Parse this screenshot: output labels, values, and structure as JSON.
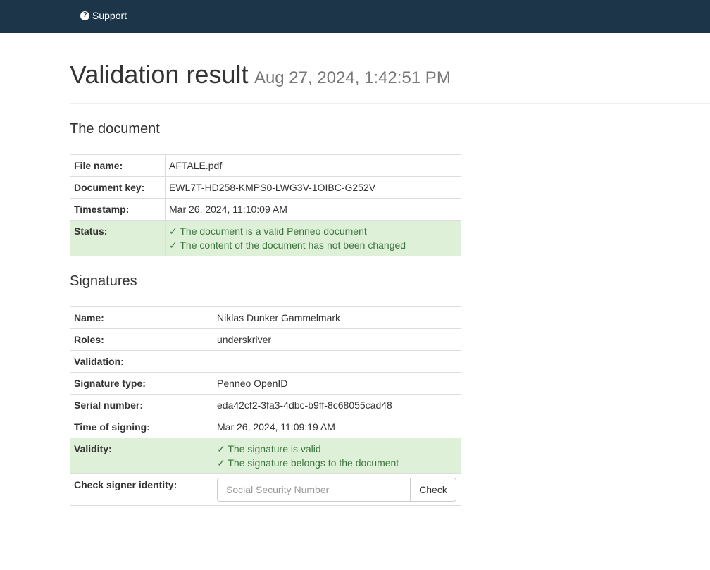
{
  "nav": {
    "support_label": "Support",
    "support_icon": "question-circle-icon"
  },
  "header": {
    "title": "Validation result",
    "timestamp": "Aug 27, 2024, 1:42:51 PM"
  },
  "document_section": {
    "title": "The document",
    "rows": [
      {
        "key": "File name:",
        "value": "AFTALE.pdf"
      },
      {
        "key": "Document key:",
        "value": "EWL7T-HD258-KMPS0-LWG3V-1OIBC-G252V"
      },
      {
        "key": "Timestamp:",
        "value": "Mar 26, 2024, 11:10:09 AM"
      }
    ],
    "status": {
      "key": "Status:",
      "lines": [
        "✓ The document is a valid Penneo document",
        "✓ The content of the document has not been changed"
      ]
    }
  },
  "signatures_section": {
    "title": "Signatures",
    "rows": [
      {
        "key": "Name:",
        "value": "Niklas Dunker Gammelmark"
      },
      {
        "key": "Roles:",
        "value": "underskriver"
      },
      {
        "key": "Validation:",
        "value": ""
      },
      {
        "key": "Signature type:",
        "value": "Penneo OpenID"
      },
      {
        "key": "Serial number:",
        "value": "eda42cf2-3fa3-4dbc-b9ff-8c68055cad48"
      },
      {
        "key": "Time of signing:",
        "value": "Mar 26, 2024, 11:09:19 AM"
      }
    ],
    "validity": {
      "key": "Validity:",
      "lines": [
        "✓ The signature is valid",
        "✓ The signature belongs to the document"
      ]
    },
    "identity": {
      "key": "Check signer identity:",
      "placeholder": "Social Security Number",
      "value": "",
      "button_label": "Check"
    }
  },
  "colors": {
    "navbar": "#1d3548",
    "success_bg": "#dff0d8",
    "success_text": "#3c763d"
  }
}
